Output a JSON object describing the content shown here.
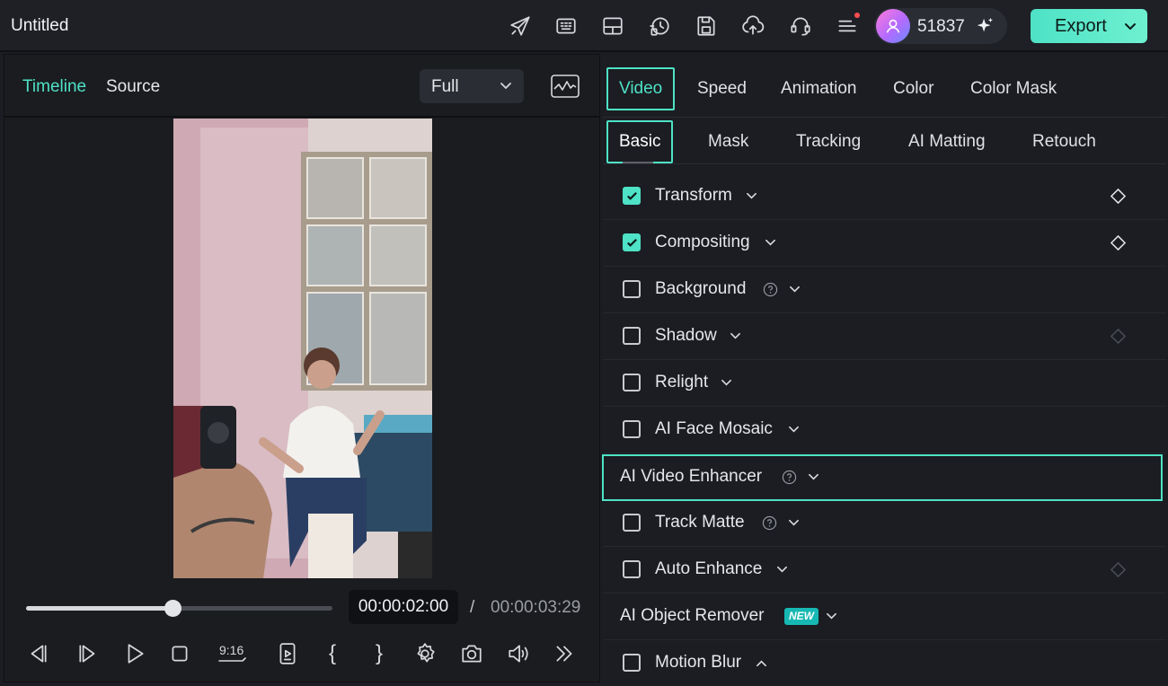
{
  "app": {
    "title": "Untitled"
  },
  "topbar": {
    "icons": [
      "send-icon",
      "keyboard-icon",
      "layout-icon",
      "history-icon",
      "save-icon",
      "cloud-upload-icon",
      "support-icon",
      "menu-icon"
    ],
    "credits": "51837",
    "export_label": "Export"
  },
  "preview": {
    "tabs": [
      "Timeline",
      "Source"
    ],
    "active_tab": "Timeline",
    "zoom": "Full",
    "progress": 0.48,
    "current_time": "00:00:02:00",
    "separator": "/",
    "total_time": "00:00:03:29",
    "controls": [
      "prev-frame-icon",
      "next-frame-icon",
      "play-icon",
      "stop-icon",
      "aspect-ratio-icon",
      "clip-marker-icon",
      "mark-in-icon",
      "mark-out-icon",
      "settings-icon",
      "snapshot-icon",
      "volume-icon",
      "more-icon"
    ],
    "aspect_label": "9:16",
    "mark_in": "{",
    "mark_out": "}"
  },
  "inspector": {
    "tabs": [
      "Video",
      "Speed",
      "Animation",
      "Color",
      "Color Mask"
    ],
    "active_tab": "Video",
    "subtabs": [
      "Basic",
      "Mask",
      "Tracking",
      "AI Matting",
      "Retouch"
    ],
    "active_subtab": "Basic",
    "properties": [
      {
        "label": "Transform",
        "checkbox": true,
        "checked": true,
        "help": false,
        "keyframe": "active"
      },
      {
        "label": "Compositing",
        "checkbox": true,
        "checked": true,
        "help": false,
        "keyframe": "active"
      },
      {
        "label": "Background",
        "checkbox": true,
        "checked": false,
        "help": true,
        "keyframe": "none"
      },
      {
        "label": "Shadow",
        "checkbox": true,
        "checked": false,
        "help": false,
        "keyframe": "dim"
      },
      {
        "label": "Relight",
        "checkbox": true,
        "checked": false,
        "help": false,
        "keyframe": "none"
      },
      {
        "label": "AI Face Mosaic",
        "checkbox": true,
        "checked": false,
        "help": false,
        "keyframe": "none"
      },
      {
        "label": "AI Video Enhancer",
        "checkbox": false,
        "checked": false,
        "help": true,
        "keyframe": "none",
        "highlighted": true
      },
      {
        "label": "Track Matte",
        "checkbox": true,
        "checked": false,
        "help": true,
        "keyframe": "none"
      },
      {
        "label": "Auto Enhance",
        "checkbox": true,
        "checked": false,
        "help": false,
        "keyframe": "dim"
      },
      {
        "label": "AI Object Remover",
        "checkbox": false,
        "checked": false,
        "help": false,
        "keyframe": "none",
        "badge": "NEW"
      },
      {
        "label": "Motion Blur",
        "checkbox": true,
        "checked": false,
        "help": false,
        "keyframe": "none",
        "expanded": true
      }
    ]
  },
  "colors": {
    "accent": "#4ee2c6",
    "background": "#1b1d22",
    "badge": "#17b8b3"
  }
}
